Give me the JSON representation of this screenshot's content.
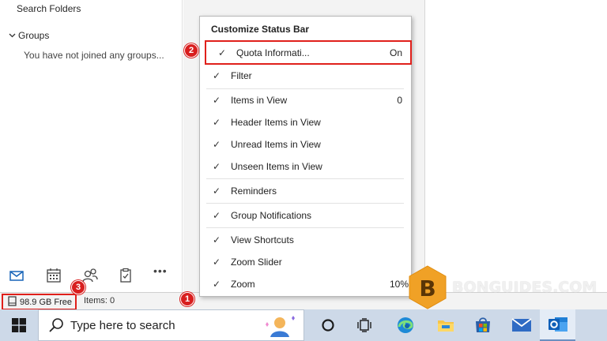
{
  "folder_pane": {
    "search_folders": "Search Folders",
    "groups_label": "Groups",
    "groups_message": "You have not joined any groups..."
  },
  "nav": {
    "icons": [
      "mail-icon",
      "calendar-icon",
      "people-icon",
      "tasks-icon",
      "more-icon"
    ],
    "more_label": "•••"
  },
  "status_bar": {
    "quota": "98.9 GB Free",
    "items": "Items: 0"
  },
  "context_menu": {
    "title": "Customize Status Bar",
    "items": [
      {
        "label": "Quota Informati...",
        "checked": true,
        "value": "On"
      },
      {
        "label": "Filter",
        "checked": true,
        "value": ""
      },
      {
        "label": "Items in View",
        "checked": true,
        "value": "0"
      },
      {
        "label": "Header Items in View",
        "checked": true,
        "value": ""
      },
      {
        "label": "Unread Items in View",
        "checked": true,
        "value": ""
      },
      {
        "label": "Unseen Items in View",
        "checked": true,
        "value": ""
      },
      {
        "label": "Reminders",
        "checked": true,
        "value": ""
      },
      {
        "label": "Group Notifications",
        "checked": true,
        "value": ""
      },
      {
        "label": "View Shortcuts",
        "checked": true,
        "value": ""
      },
      {
        "label": "Zoom Slider",
        "checked": true,
        "value": ""
      },
      {
        "label": "Zoom",
        "checked": true,
        "value": "10%"
      }
    ],
    "check_glyph": "✓"
  },
  "callouts": {
    "one": "1",
    "two": "2",
    "three": "3"
  },
  "watermark": {
    "logo_letter": "B",
    "text": "BONGUIDES.COM"
  },
  "taskbar": {
    "search_placeholder": "Type here to search",
    "accent": "#0078d4"
  }
}
